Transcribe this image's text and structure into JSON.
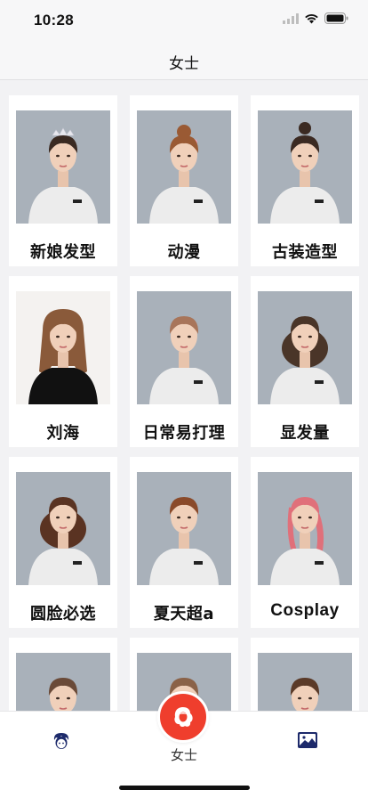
{
  "status_bar": {
    "time": "10:28",
    "icons": [
      "signal-icon",
      "wifi-icon",
      "battery-icon"
    ]
  },
  "nav": {
    "title": "女士"
  },
  "categories": [
    {
      "label": "新娘发型",
      "hair": "#3a2a22",
      "style": "updo-tiara"
    },
    {
      "label": "动漫",
      "hair": "#9a5a34",
      "style": "bun-flower"
    },
    {
      "label": "古装造型",
      "hair": "#3b2a22",
      "style": "high-bun"
    },
    {
      "label": "刘海",
      "hair": "#8a5a3a",
      "style": "bangs-photo"
    },
    {
      "label": "日常易打理",
      "hair": "#a8755a",
      "style": "short-bob"
    },
    {
      "label": "显发量",
      "hair": "#4a3528",
      "style": "curly-bob"
    },
    {
      "label": "圆脸必选",
      "hair": "#5a3322",
      "style": "wavy-mid"
    },
    {
      "label": "夏天超a",
      "hair": "#8a4a2a",
      "style": "pixie"
    },
    {
      "label": "Cosplay",
      "hair": "#e0707a",
      "style": "pink-braid"
    },
    {
      "label": "",
      "hair": "#6a4a38",
      "style": "bangs"
    },
    {
      "label": "",
      "hair": "#8a6248",
      "style": "updo"
    },
    {
      "label": "",
      "hair": "#5a3a28",
      "style": "layered"
    }
  ],
  "tab_bar": {
    "left_icon": "avatar-icon",
    "center_label": "女士",
    "center_icon": "hair-style-icon",
    "right_icon": "gallery-icon",
    "accent": "#ef3e2d",
    "icon_color": "#1d2a6b"
  }
}
